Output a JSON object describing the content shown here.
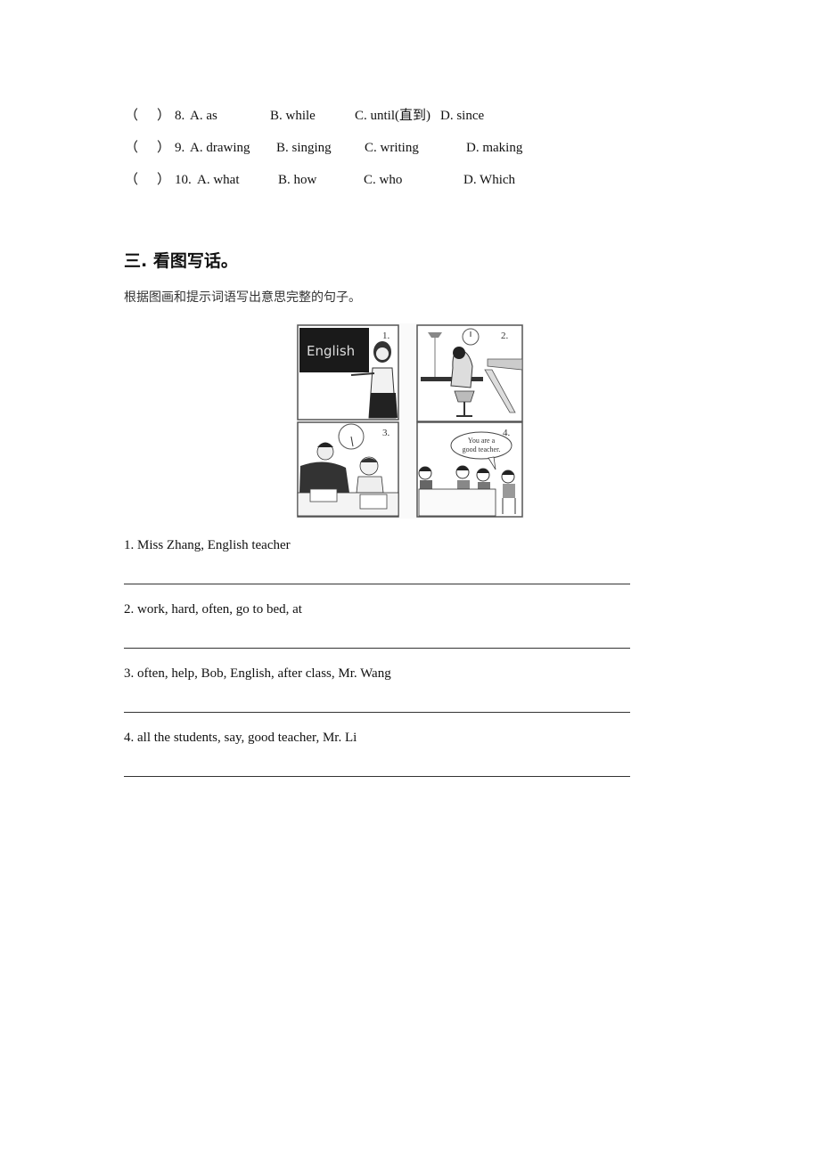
{
  "mc_questions": [
    {
      "paren": "（",
      "close": "）",
      "number": "8.",
      "options": [
        "A. as",
        "B. while",
        "C. until(直到)",
        "D. since"
      ]
    },
    {
      "paren": "（",
      "close": "）",
      "number": "9.",
      "options": [
        "A. drawing",
        "B. singing",
        "C. writing",
        "D. making"
      ]
    },
    {
      "paren": "（",
      "close": "）",
      "number": "10.",
      "options": [
        "A. what",
        "B. how",
        "C. who",
        "D. Which"
      ]
    }
  ],
  "section": {
    "title": "三. 看图写话。",
    "instruction": "根据图画和提示词语写出意思完整的句子。"
  },
  "comic": {
    "panels": [
      {
        "number": "1.",
        "board_text": "English"
      },
      {
        "number": "2."
      },
      {
        "number": "3."
      },
      {
        "number": "4.",
        "bubble_line1": "You are a",
        "bubble_line2": "good teacher."
      }
    ]
  },
  "prompts": [
    "1. Miss Zhang, English teacher",
    "2. work, hard, often, go to bed, at",
    "3. often, help, Bob, English, after class, Mr. Wang",
    "4. all the students, say, good teacher, Mr. Li"
  ]
}
